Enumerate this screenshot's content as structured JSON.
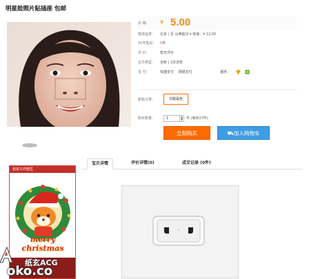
{
  "product": {
    "title": "明星脸照片贴插座 包邮"
  },
  "price": {
    "label": "价 格：",
    "currency": "¥",
    "value": "5.00"
  },
  "shipping": {
    "label": "物流运费：",
    "text": "北京 | 至 山西临汾 ▾   快递：¥ 12.00"
  },
  "sales": {
    "label": "30天售出：",
    "count": "0",
    "unit": "件"
  },
  "rating": {
    "label": "评 价：",
    "text": "暂无评价"
  },
  "type": {
    "label": "宝贝类型：",
    "text": "全新 | 3次浏览"
  },
  "payment": {
    "label": "支 付：",
    "methods": [
      "快捷支付",
      "网银支付"
    ],
    "service_label": "服务："
  },
  "color": {
    "label": "颜色分类：",
    "option": "文胶黑色"
  },
  "quantity": {
    "label": "购买数量：",
    "value": "1",
    "stock": "件 (库存27件)"
  },
  "buttons": {
    "buy": "立刻购买",
    "cart": "加入购物车"
  },
  "sidebar": {
    "header": "自定义内容区",
    "banner_text": "merry christmas"
  },
  "tabs": [
    {
      "label": "宝贝详情"
    },
    {
      "label": "评价详情(0)"
    },
    {
      "label": "成交记录 (0件)"
    }
  ],
  "watermark": {
    "top": "纸玄ACG",
    "bottom": "oko.co"
  },
  "colors": {
    "price": "#f38c12",
    "buy_button": "#ff6a00",
    "cart_button": "#3e9de3",
    "sidebar_red": "#c3302b"
  }
}
